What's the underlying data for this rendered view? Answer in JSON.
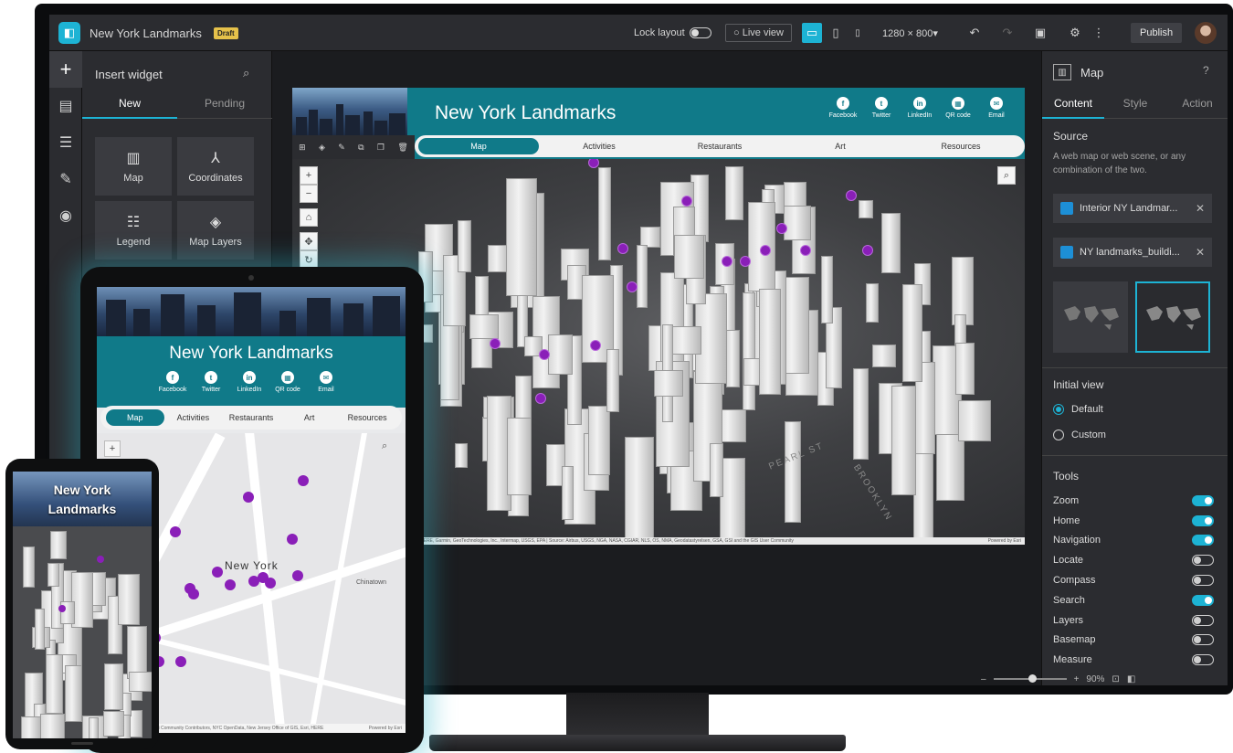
{
  "header": {
    "app_title": "New York Landmarks",
    "status_badge": "Draft",
    "lock_layout_label": "Lock layout",
    "live_view_label": "Live view",
    "resolution": "1280 × 800▾",
    "publish_label": "Publish"
  },
  "insert_panel": {
    "title": "Insert widget",
    "tabs": [
      "New",
      "Pending"
    ],
    "widgets": [
      {
        "label": "Map",
        "icon": "map-icon"
      },
      {
        "label": "Coordinates",
        "icon": "coordinates-icon"
      },
      {
        "label": "Legend",
        "icon": "legend-icon"
      },
      {
        "label": "Map Layers",
        "icon": "layers-icon"
      }
    ]
  },
  "app": {
    "title": "New York Landmarks",
    "social": [
      {
        "label": "Facebook",
        "glyph": "f"
      },
      {
        "label": "Twitter",
        "glyph": "t"
      },
      {
        "label": "LinkedIn",
        "glyph": "in"
      },
      {
        "label": "QR code",
        "glyph": "▦"
      },
      {
        "label": "Email",
        "glyph": "✉"
      }
    ],
    "nav": [
      "Map",
      "Activities",
      "Restaurants",
      "Art",
      "Resources"
    ],
    "active_nav": "Map",
    "attribution": "HERE, Garmin, GeoTechnologies, Inc., Intermap, USGS, EPA | Source: Airbus, USGS, NGA, NASA, CGIAR, NLS, OS, NMA, Geodatastyrelsen, GSA, GSI and the GIS User Community",
    "attribution_right": "Powered by Esri",
    "street_labels": [
      "PEARL ST",
      "BROOKLYN"
    ]
  },
  "right_panel": {
    "title": "Map",
    "tabs": [
      "Content",
      "Style",
      "Action"
    ],
    "source_heading": "Source",
    "source_desc": "A web map or web scene, or any combination of the two.",
    "sources": [
      "Interior NY Landmar...",
      "NY landmarks_buildi..."
    ],
    "initial_view_heading": "Initial view",
    "initial_view_options": [
      "Default",
      "Custom"
    ],
    "selected_initial_view": "Default",
    "tools_heading": "Tools",
    "tools": [
      {
        "label": "Zoom",
        "on": true
      },
      {
        "label": "Home",
        "on": true
      },
      {
        "label": "Navigation",
        "on": true
      },
      {
        "label": "Locate",
        "on": false
      },
      {
        "label": "Compass",
        "on": false
      },
      {
        "label": "Search",
        "on": true
      },
      {
        "label": "Layers",
        "on": false
      },
      {
        "label": "Basemap",
        "on": false
      },
      {
        "label": "Measure",
        "on": false
      }
    ]
  },
  "zoom": {
    "value": "90%",
    "minus": "–",
    "plus": "+"
  },
  "tablet": {
    "title": "New York Landmarks",
    "nav": [
      "Map",
      "Activities",
      "Restaurants",
      "Art",
      "Resources"
    ],
    "city_label": "New York",
    "neighborhood_label": "Chinatown",
    "attribution": "Esri Community Contributors, NYC OpenData, New Jersey Office of GIS, Esri, HERE",
    "attribution_right": "Powered by Esri"
  },
  "phone": {
    "title_line1": "New York",
    "title_line2": "Landmarks"
  },
  "colors": {
    "accent": "#1db3d4",
    "teal": "#107a89",
    "pin": "#8a1fb8"
  }
}
